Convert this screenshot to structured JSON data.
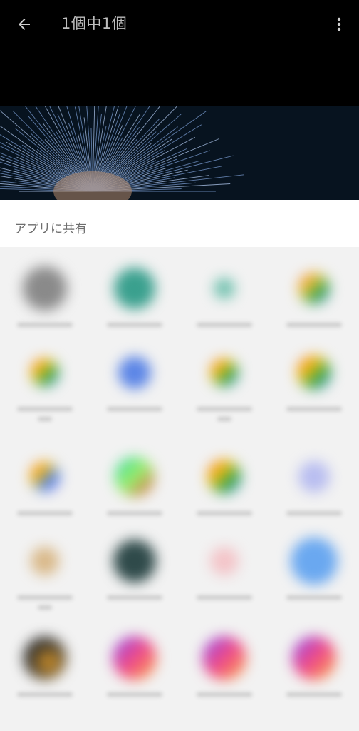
{
  "header": {
    "title": "1個中1個",
    "back_icon": "arrow-left-icon",
    "more_icon": "more-vert-icon"
  },
  "share_sheet": {
    "title": "アプリに共有"
  },
  "colors": {
    "topbar_bg": "#000000",
    "sheet_bg": "#f2f2f2",
    "sheet_header_bg": "#ffffff"
  }
}
